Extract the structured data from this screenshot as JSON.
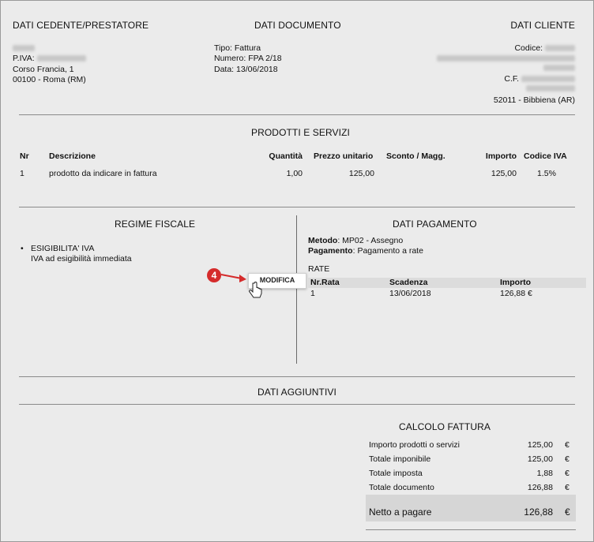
{
  "cedente": {
    "heading": "DATI CEDENTE/PRESTATORE",
    "piva_label": "P.IVA:",
    "address1": "Corso Francia, 1",
    "address2": "00100 - Roma (RM)"
  },
  "documento": {
    "heading": "DATI DOCUMENTO",
    "tipo": "Tipo: Fattura",
    "numero_label": "Numero:",
    "numero_value": "FPA 2/18",
    "data": "Data: 13/06/2018"
  },
  "cliente": {
    "heading": "DATI CLIENTE",
    "codice_label": "Codice:",
    "cf_label": "C.F.",
    "city": "52011 - Bibbiena (AR)"
  },
  "prodotti": {
    "heading": "PRODOTTI E SERVIZI",
    "columns": [
      "Nr",
      "Descrizione",
      "Quantità",
      "Prezzo unitario",
      "Sconto / Magg.",
      "Importo",
      "Codice IVA"
    ],
    "rows": [
      [
        "1",
        "prodotto da indicare in fattura",
        "1,00",
        "125,00",
        "",
        "125,00",
        "1.5%"
      ]
    ]
  },
  "regime": {
    "heading": "REGIME FISCALE",
    "item_title": "ESIGIBILITA' IVA",
    "item_desc": "IVA ad esigibilità immediata"
  },
  "pagamento": {
    "heading": "DATI PAGAMENTO",
    "metodo_label": "Metodo",
    "metodo_value": ": MP02 - Assegno",
    "pagamento_label": "Pagamento",
    "pagamento_value": ": Pagamento a rate",
    "rate_label": "RATE",
    "columns": [
      "Nr.Rata",
      "Scadenza",
      "Importo"
    ],
    "rows": [
      [
        "1",
        "13/06/2018",
        "126,88 €"
      ]
    ]
  },
  "modifica_button": "MODIFICA",
  "step_badge": "4",
  "aggiuntivi": {
    "heading": "DATI AGGIUNTIVI"
  },
  "calcolo": {
    "heading": "CALCOLO FATTURA",
    "rows": [
      {
        "label": "Importo prodotti o servizi",
        "value": "125,00",
        "cur": "€"
      },
      {
        "label": "Totale imponibile",
        "value": "125,00",
        "cur": "€"
      },
      {
        "label": "Totale imposta",
        "value": "1,88",
        "cur": "€"
      },
      {
        "label": "Totale documento",
        "value": "126,88",
        "cur": "€"
      }
    ],
    "netto_label": "Netto a pagare",
    "netto_value": "126,88",
    "netto_cur": "€"
  },
  "colors": {
    "badge": "#d52b2b",
    "background": "#ebebeb"
  }
}
